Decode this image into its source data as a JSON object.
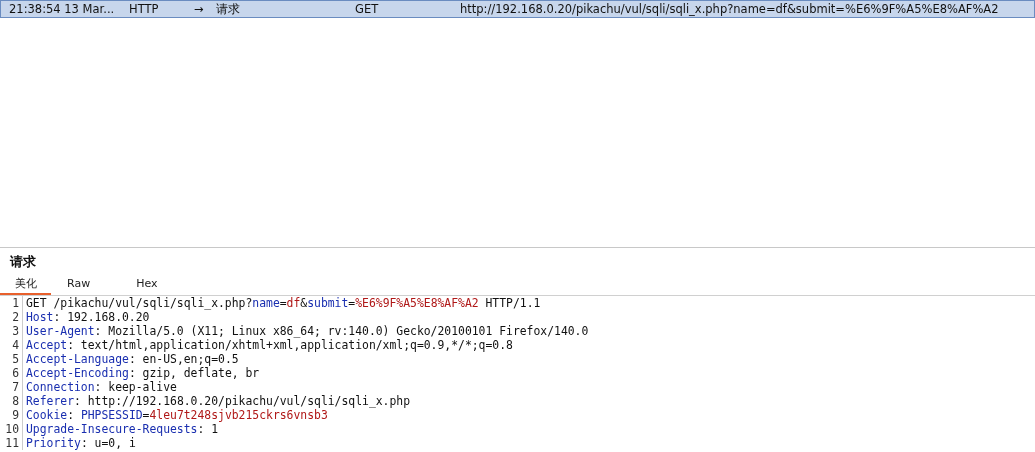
{
  "history": [
    {
      "time": "21:38:54 13 Mar...",
      "type": "HTTP",
      "direction": "→",
      "message": "请求",
      "method": "GET",
      "url": "http://192.168.0.20/pikachu/vul/sqli/sqli_x.php?name=df&submit=%E6%9F%A5%E8%AF%A2",
      "selected": true
    }
  ],
  "pane": {
    "title": "请求",
    "tabs": [
      {
        "label": "美化",
        "selected": true
      },
      {
        "label": "Raw",
        "selected": false
      },
      {
        "label": "Hex",
        "selected": false
      }
    ],
    "lines": [
      {
        "number": "1",
        "segments": [
          {
            "kind": "plain",
            "text": "GET /pikachu/vul/sqli/sqli_x.php?"
          },
          {
            "kind": "key",
            "text": "name"
          },
          {
            "kind": "plain",
            "text": "="
          },
          {
            "kind": "value",
            "text": "df"
          },
          {
            "kind": "plain",
            "text": "&"
          },
          {
            "kind": "key",
            "text": "submit"
          },
          {
            "kind": "plain",
            "text": "="
          },
          {
            "kind": "value",
            "text": "%E6%9F%A5%E8%AF%A2"
          },
          {
            "kind": "plain",
            "text": " HTTP/1.1"
          }
        ]
      },
      {
        "number": "2",
        "segments": [
          {
            "kind": "key",
            "text": "Host"
          },
          {
            "kind": "plain",
            "text": ": 192.168.0.20"
          }
        ]
      },
      {
        "number": "3",
        "segments": [
          {
            "kind": "key",
            "text": "User-Agent"
          },
          {
            "kind": "plain",
            "text": ": Mozilla/5.0 (X11; Linux x86_64; rv:140.0) Gecko/20100101 Firefox/140.0"
          }
        ]
      },
      {
        "number": "4",
        "segments": [
          {
            "kind": "key",
            "text": "Accept"
          },
          {
            "kind": "plain",
            "text": ": text/html,application/xhtml+xml,application/xml;q=0.9,*/*;q=0.8"
          }
        ]
      },
      {
        "number": "5",
        "segments": [
          {
            "kind": "key",
            "text": "Accept-Language"
          },
          {
            "kind": "plain",
            "text": ": en-US,en;q=0.5"
          }
        ]
      },
      {
        "number": "6",
        "segments": [
          {
            "kind": "key",
            "text": "Accept-Encoding"
          },
          {
            "kind": "plain",
            "text": ": gzip, deflate, br"
          }
        ]
      },
      {
        "number": "7",
        "segments": [
          {
            "kind": "key",
            "text": "Connection"
          },
          {
            "kind": "plain",
            "text": ": keep-alive"
          }
        ]
      },
      {
        "number": "8",
        "segments": [
          {
            "kind": "key",
            "text": "Referer"
          },
          {
            "kind": "plain",
            "text": ": http://192.168.0.20/pikachu/vul/sqli/sqli_x.php"
          }
        ]
      },
      {
        "number": "9",
        "segments": [
          {
            "kind": "key",
            "text": "Cookie"
          },
          {
            "kind": "plain",
            "text": ": "
          },
          {
            "kind": "key",
            "text": "PHPSESSID"
          },
          {
            "kind": "plain",
            "text": "="
          },
          {
            "kind": "value",
            "text": "4leu7t248sjvb215ckrs6vnsb3"
          }
        ]
      },
      {
        "number": "10",
        "segments": [
          {
            "kind": "key",
            "text": "Upgrade-Insecure-Requests"
          },
          {
            "kind": "plain",
            "text": ": 1"
          }
        ]
      },
      {
        "number": "11",
        "segments": [
          {
            "kind": "key",
            "text": "Priority"
          },
          {
            "kind": "plain",
            "text": ": u=0, i"
          }
        ]
      }
    ]
  }
}
